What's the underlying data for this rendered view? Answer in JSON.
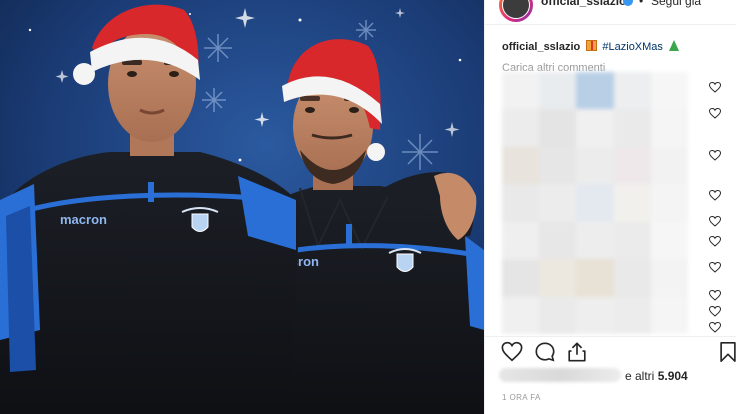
{
  "post": {
    "account": "official_sslazio",
    "follow_state": "Segui già",
    "separator": "•",
    "caption_user": "official_sslazio",
    "caption_hashtag": "#LazioXMas",
    "caption_emoji_1": "gift-emoji",
    "caption_emoji_2": "christmas-tree-emoji",
    "load_more_comments": "Carica altri commenti",
    "likes_suffix": "e altri",
    "likes_count": "5.904",
    "timestamp": "1 ORA FA"
  },
  "media": {
    "jersey_brand": "macron"
  },
  "icons": {
    "like": "heart-icon",
    "comment": "comment-icon",
    "share": "share-icon",
    "save": "bookmark-icon",
    "comment_like": "heart-icon"
  },
  "colors": {
    "link": "#003569",
    "muted": "#999999",
    "verified": "#3897f0",
    "border": "#efefef"
  }
}
